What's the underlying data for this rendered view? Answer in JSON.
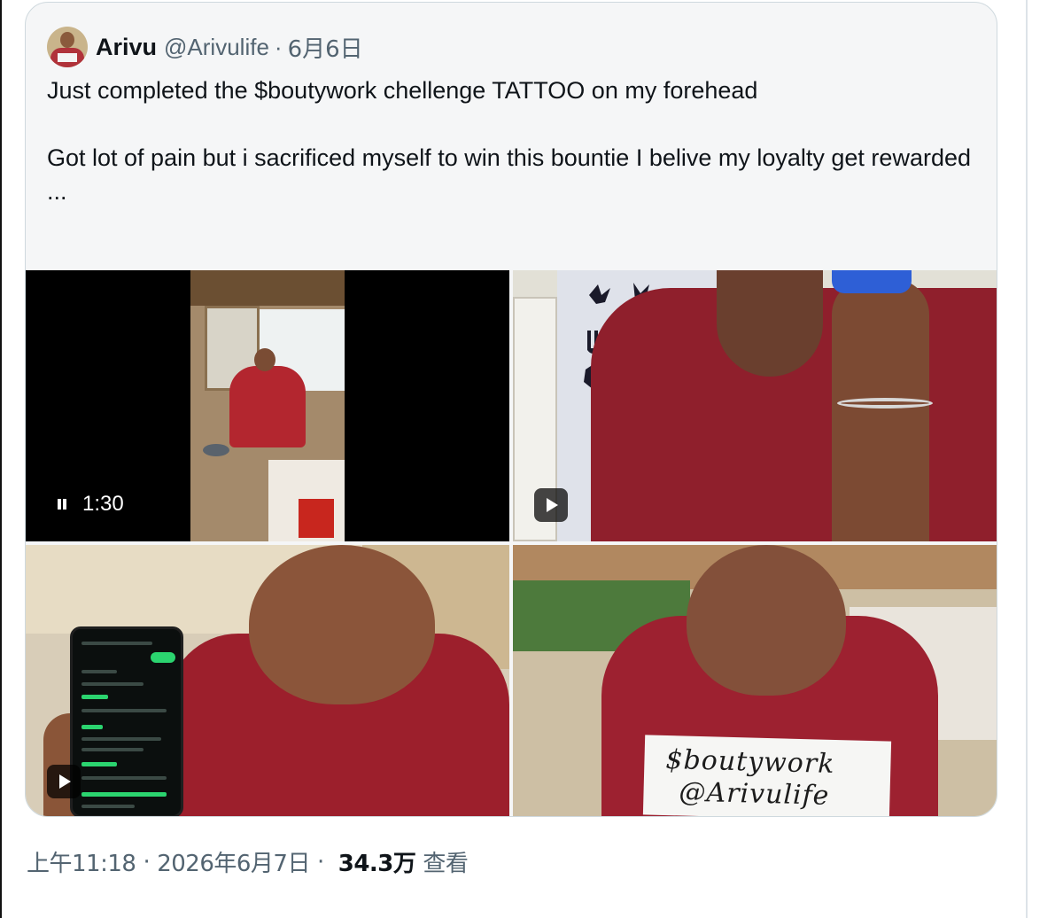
{
  "quoted_tweet": {
    "display_name": "Arivu",
    "handle": "@Arivulife",
    "separator": "·",
    "date": "6月6日",
    "text_lines": [
      "Just completed the $boutywork chellenge TATTOO on my forehead",
      "Got lot of pain but i sacrificed myself to win this bountie I belive my loyalty get rewarded",
      "..."
    ],
    "media": {
      "video_duration": "1:30",
      "sign_line_1": "$boutywork",
      "sign_line_2": "@Arivulife"
    }
  },
  "meta": {
    "time": "上午11:18",
    "separator": "·",
    "full_date": "2026年6月7日",
    "separator2": "·",
    "views_count": "34.3万",
    "views_label": "查看"
  }
}
